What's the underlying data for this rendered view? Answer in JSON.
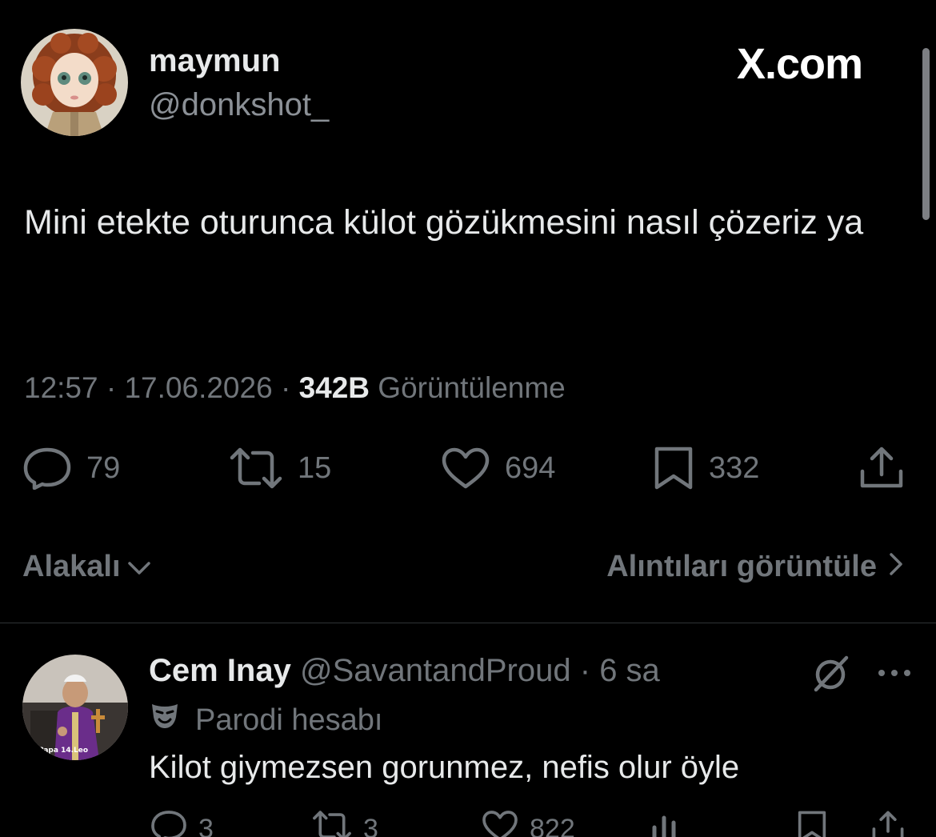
{
  "tweet": {
    "display_name": "maymun",
    "handle": "@donkshot_",
    "brand": "X.com",
    "text": "Mini etekte oturunca külot gözükmesini nasıl çözeriz ya",
    "time": "12:57",
    "date": "17.06.2026",
    "separator": "·",
    "views_count": "342B",
    "views_label": "Görüntülenme",
    "actions": {
      "replies": "79",
      "reposts": "15",
      "likes": "694",
      "bookmarks": "332"
    },
    "sort_label": "Alakalı",
    "quotes_label": "Alıntıları görüntüle"
  },
  "reply": {
    "display_name": "Cem Inay",
    "handle": "@SavantandProud",
    "time": "6 sa",
    "separator": "·",
    "badge": "Parodi hesabı",
    "avatar_caption": "Papa 14.Leo",
    "text": "Kilot giymezsen gorunmez, nefis olur öyle",
    "actions": {
      "replies": "3",
      "reposts": "3",
      "likes": "822"
    }
  },
  "colors": {
    "background": "#000000",
    "primary_text": "#e7e9ea",
    "secondary_text": "#71767b",
    "divider": "#2f3336"
  },
  "icons": [
    "reply-icon",
    "repost-icon",
    "like-icon",
    "bookmark-icon",
    "share-icon",
    "chevron-down-icon",
    "chevron-right-icon",
    "grok-icon",
    "more-icon",
    "parody-mask-icon"
  ]
}
